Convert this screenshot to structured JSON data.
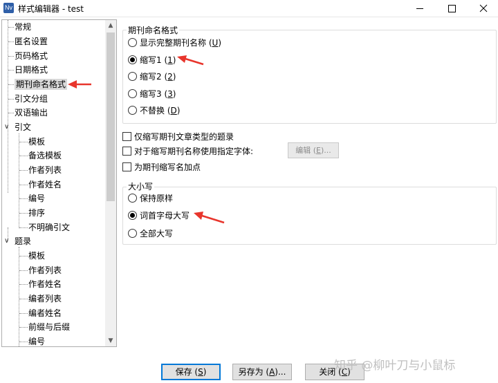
{
  "window": {
    "icon_text": "Nv",
    "title": "样式编辑器 - test"
  },
  "tree": {
    "items": [
      {
        "label": "常规",
        "level": 0
      },
      {
        "label": "匿名设置",
        "level": 0
      },
      {
        "label": "页码格式",
        "level": 0
      },
      {
        "label": "日期格式",
        "level": 0
      },
      {
        "label": "期刊命名格式",
        "level": 0,
        "selected": true
      },
      {
        "label": "引文分组",
        "level": 0
      },
      {
        "label": "双语输出",
        "level": 0
      },
      {
        "label": "引文",
        "level": 0,
        "expanded": true
      },
      {
        "label": "模板",
        "level": 1
      },
      {
        "label": "备选模板",
        "level": 1
      },
      {
        "label": "作者列表",
        "level": 1
      },
      {
        "label": "作者姓名",
        "level": 1
      },
      {
        "label": "编号",
        "level": 1
      },
      {
        "label": "排序",
        "level": 1
      },
      {
        "label": "不明确引文",
        "level": 1
      },
      {
        "label": "题录",
        "level": 0,
        "expanded": true
      },
      {
        "label": "模板",
        "level": 1
      },
      {
        "label": "作者列表",
        "level": 1
      },
      {
        "label": "作者姓名",
        "level": 1
      },
      {
        "label": "编者列表",
        "level": 1
      },
      {
        "label": "编者姓名",
        "level": 1
      },
      {
        "label": "前缀与后缀",
        "level": 1
      },
      {
        "label": "编号",
        "level": 1
      }
    ]
  },
  "journal_group": {
    "title": "期刊命名格式",
    "options": [
      {
        "label": "显示完整期刊名称",
        "key": "U",
        "selected": false
      },
      {
        "label": "缩写1",
        "key": "1",
        "selected": true
      },
      {
        "label": "缩写2",
        "key": "2",
        "selected": false
      },
      {
        "label": "缩写3",
        "key": "3",
        "selected": false
      },
      {
        "label": "不替换",
        "key": "D",
        "selected": false
      }
    ]
  },
  "checkboxes": [
    {
      "label": "仅缩写期刊文章类型的题录",
      "checked": false
    },
    {
      "label": "对于缩写期刊名称使用指定字体:",
      "checked": false
    },
    {
      "label": "为期刊缩写名加点",
      "checked": false
    }
  ],
  "edit_button": {
    "label": "编辑",
    "key": "E",
    "suffix": "..."
  },
  "case_group": {
    "title": "大小写",
    "options": [
      {
        "label": "保持原样",
        "selected": false
      },
      {
        "label": "词首字母大写",
        "selected": true
      },
      {
        "label": "全部大写",
        "selected": false
      }
    ]
  },
  "buttons": {
    "save": {
      "label": "保存",
      "key": "S"
    },
    "save_as": {
      "label": "另存为",
      "key": "A",
      "suffix": "..."
    },
    "close": {
      "label": "关闭",
      "key": "C"
    }
  },
  "watermark": "知乎 @柳叶刀与小鼠标",
  "colors": {
    "annotation_arrow": "#e8352c",
    "selection": "#d9d9d9"
  }
}
